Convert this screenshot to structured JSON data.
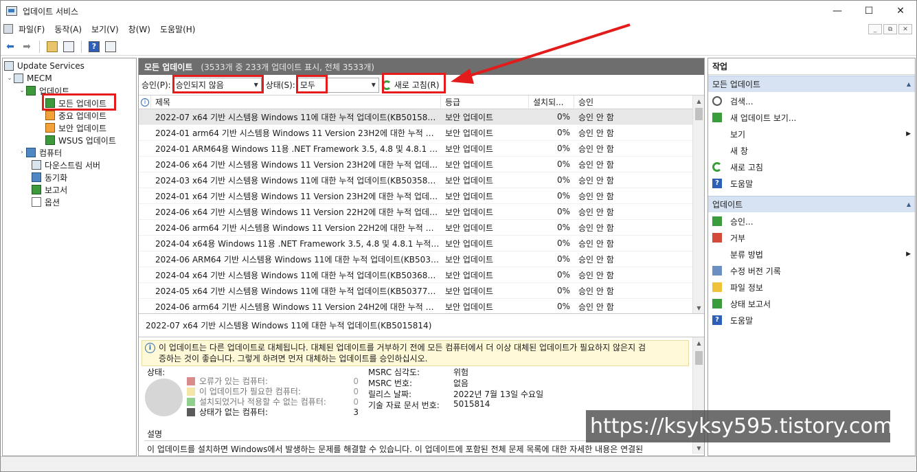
{
  "window": {
    "title": "업데이트 서비스",
    "min": "—",
    "max": "☐",
    "close": "✕"
  },
  "menu": {
    "items": [
      "파일(F)",
      "동작(A)",
      "보기(V)",
      "창(W)",
      "도움말(H)"
    ]
  },
  "tree": {
    "root": "Update Services",
    "server": "MECM",
    "updates": "업데이트",
    "all_updates": "모든 업데이트",
    "critical": "중요 업데이트",
    "security": "보안 업데이트",
    "wsus": "WSUS 업데이트",
    "computers": "컴퓨터",
    "downstream": "다운스트림 서버",
    "sync": "동기화",
    "reports": "보고서",
    "options": "옵션"
  },
  "center": {
    "title": "모든 업데이트",
    "subtitle": "(3533개 중 233개 업데이트 표시, 전체 3533개)",
    "approval_label": "승인(P):",
    "approval_value": "승인되지 않음",
    "status_label": "상태(S):",
    "status_value": "모두",
    "refresh_label": "새로 고침(R)"
  },
  "grid": {
    "headers": {
      "info": "i",
      "title": "제목",
      "classification": "등급",
      "installed": "설치되...",
      "approval": "승인"
    },
    "rows": [
      {
        "title": "2022-07 x64 기반 시스템용 Windows 11에 대한 누적 업데이트(KB5015814)",
        "classification": "보안 업데이트",
        "installed": "0%",
        "approval": "승인 안 함"
      },
      {
        "title": "2024-01 arm64 기반 시스템용 Windows 11 Version 23H2에 대한 누적 업...",
        "classification": "보안 업데이트",
        "installed": "0%",
        "approval": "승인 안 함"
      },
      {
        "title": "2024-01 ARM64용 Windows 11용 .NET Framework 3.5, 4.8 및 4.8.1 누적 ...",
        "classification": "보안 업데이트",
        "installed": "0%",
        "approval": "승인 안 함"
      },
      {
        "title": "2024-06 x64 기반 시스템용 Windows 11 Version 23H2에 대한 누적 업데이...",
        "classification": "보안 업데이트",
        "installed": "0%",
        "approval": "승인 안 함"
      },
      {
        "title": "2024-03 x64 기반 시스템용 Windows 11에 대한 누적 업데이트(KB5035854)",
        "classification": "보안 업데이트",
        "installed": "0%",
        "approval": "승인 안 함"
      },
      {
        "title": "2024-01 x64 기반 시스템용 Windows 11 Version 23H2에 대한 누적 업데이...",
        "classification": "보안 업데이트",
        "installed": "0%",
        "approval": "승인 안 함"
      },
      {
        "title": "2024-06 x64 기반 시스템용 Windows 11 Version 22H2에 대한 누적 업데이...",
        "classification": "보안 업데이트",
        "installed": "0%",
        "approval": "승인 안 함"
      },
      {
        "title": "2024-06 arm64 기반 시스템용 Windows 11 Version 22H2에 대한 누적 업...",
        "classification": "보안 업데이트",
        "installed": "0%",
        "approval": "승인 안 함"
      },
      {
        "title": "2024-04 x64용 Windows 11용 .NET Framework 3.5, 4.8 및 4.8.1 누적 업데...",
        "classification": "보안 업데이트",
        "installed": "0%",
        "approval": "승인 안 함"
      },
      {
        "title": "2024-06 ARM64 기반 시스템용 Windows 11에 대한 누적 업데이트(KB5039...",
        "classification": "보안 업데이트",
        "installed": "0%",
        "approval": "승인 안 함"
      },
      {
        "title": "2024-04 x64 기반 시스템용 Windows 11에 대한 누적 업데이트(KB5036894)",
        "classification": "보안 업데이트",
        "installed": "0%",
        "approval": "승인 안 함"
      },
      {
        "title": "2024-05 x64 기반 시스템용 Windows 11에 대한 누적 업데이트(KB5037770)",
        "classification": "보안 업데이트",
        "installed": "0%",
        "approval": "승인 안 함"
      },
      {
        "title": "2024-06 arm64 기반 시스템용 Windows 11 Version 24H2에 대한 누적 업...",
        "classification": "보안 업데이트",
        "installed": "0%",
        "approval": "승인 안 함"
      }
    ]
  },
  "details": {
    "selected_title": "2022-07 x64 기반 시스템용 Windows 11에 대한 누적 업데이트(KB5015814)",
    "warning_line1": "이 업데이트는 다른 업데이트로 대체됩니다. 대체된 업데이트를 거부하기 전에 모든 컴퓨터에서 더 이상 대체된 업데이트가 필요하지 않은지 검",
    "warning_line2": "증하는 것이 좋습니다. 그렇게 하려면 먼저 대체하는 업데이트를 승인하십시오.",
    "status_label": "상태:",
    "legend": [
      {
        "label": "오류가 있는 컴퓨터:",
        "count": "0",
        "color": "#d98b8b"
      },
      {
        "label": "이 업데이트가 필요한 컴퓨터:",
        "count": "0",
        "color": "#f4e6a6"
      },
      {
        "label": "설치되었거나 적용할 수 없는 컴퓨터:",
        "count": "0",
        "color": "#8fd08f"
      },
      {
        "label": "상태가 없는 컴퓨터:",
        "count": "3",
        "color": "#5a5a5a"
      }
    ],
    "props": [
      {
        "k": "MSRC 심각도:",
        "v": "위험"
      },
      {
        "k": "MSRC 번호:",
        "v": "없음"
      },
      {
        "k": "릴리스 날짜:",
        "v": "2022년 7월 13일 수요일"
      },
      {
        "k": "기술 자료 문서 번호:",
        "v": "5015814"
      }
    ],
    "description_label": "설명",
    "description_text": "이 업데이트를 설치하면 Windows에서 발생하는 문제를 해결할 수 있습니다. 이 업데이트에 포함된 전체 문제 목록에 대한 자세한 내용은 연결된"
  },
  "actions": {
    "header": "작업",
    "section1": "모든 업데이트",
    "section1_items": [
      {
        "label": "검색...",
        "icon": "search-icon"
      },
      {
        "label": "새 업데이트 보기...",
        "icon": "new-view-icon"
      },
      {
        "label": "보기",
        "icon": "",
        "submenu": true
      },
      {
        "label": "새 창",
        "icon": ""
      },
      {
        "label": "새로 고침",
        "icon": "refresh-icon"
      },
      {
        "label": "도움말",
        "icon": "help-icon"
      }
    ],
    "section2": "업데이트",
    "section2_items": [
      {
        "label": "승인...",
        "icon": "approve-icon"
      },
      {
        "label": "거부",
        "icon": "decline-icon"
      },
      {
        "label": "분류 방법",
        "icon": "",
        "submenu": true
      },
      {
        "label": "수정 버전 기록",
        "icon": "revision-icon"
      },
      {
        "label": "파일 정보",
        "icon": "file-info-icon"
      },
      {
        "label": "상태 보고서",
        "icon": "status-report-icon"
      },
      {
        "label": "도움말",
        "icon": "help-icon"
      }
    ]
  },
  "watermark": "https://ksyksy595.tistory.com",
  "colors": {
    "highlight": "#e31b1b",
    "header_bg": "#6e6e6e",
    "section_bg": "#d7e3f2"
  }
}
